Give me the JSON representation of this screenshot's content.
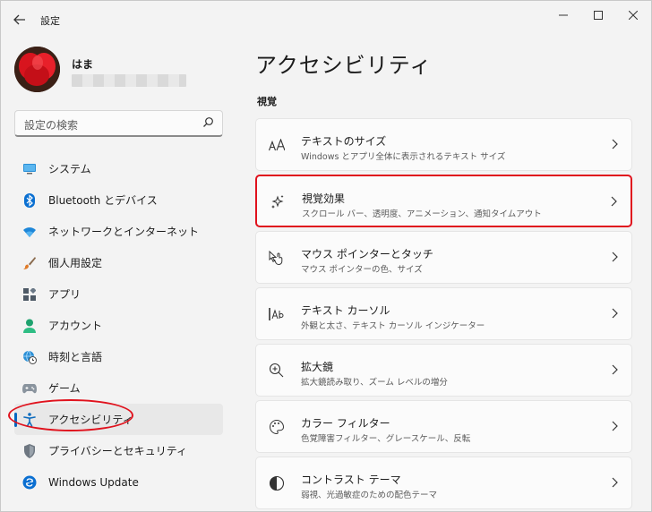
{
  "window": {
    "title": "設定"
  },
  "user": {
    "name": "はま"
  },
  "search": {
    "placeholder": "設定の検索"
  },
  "sidebar": {
    "items": [
      {
        "label": "システム",
        "icon": "monitor-icon"
      },
      {
        "label": "Bluetooth とデバイス",
        "icon": "bluetooth-icon"
      },
      {
        "label": "ネットワークとインターネット",
        "icon": "wifi-icon"
      },
      {
        "label": "個人用設定",
        "icon": "brush-icon"
      },
      {
        "label": "アプリ",
        "icon": "apps-icon"
      },
      {
        "label": "アカウント",
        "icon": "person-icon"
      },
      {
        "label": "時刻と言語",
        "icon": "globe-clock-icon"
      },
      {
        "label": "ゲーム",
        "icon": "gamepad-icon"
      },
      {
        "label": "アクセシビリティ",
        "icon": "accessibility-icon",
        "active": true
      },
      {
        "label": "プライバシーとセキュリティ",
        "icon": "shield-icon"
      },
      {
        "label": "Windows Update",
        "icon": "update-icon"
      }
    ]
  },
  "main": {
    "title": "アクセシビリティ",
    "section": "視覚",
    "cards": [
      {
        "title": "テキストのサイズ",
        "subtitle": "Windows とアプリ全体に表示されるテキスト サイズ",
        "icon": "text-size-icon"
      },
      {
        "title": "視覚効果",
        "subtitle": "スクロール バー、透明度、アニメーション、通知タイムアウト",
        "icon": "sparkle-icon"
      },
      {
        "title": "マウス ポインターとタッチ",
        "subtitle": "マウス ポインターの色、サイズ",
        "icon": "pointer-touch-icon"
      },
      {
        "title": "テキスト カーソル",
        "subtitle": "外観と太さ、テキスト カーソル インジケーター",
        "icon": "text-cursor-icon"
      },
      {
        "title": "拡大鏡",
        "subtitle": "拡大鏡読み取り、ズーム レベルの増分",
        "icon": "magnifier-icon"
      },
      {
        "title": "カラー フィルター",
        "subtitle": "色覚障害フィルター、グレースケール、反転",
        "icon": "palette-icon"
      },
      {
        "title": "コントラスト テーマ",
        "subtitle": "弱視、光過敏症のための配色テーマ",
        "icon": "contrast-icon"
      }
    ]
  }
}
